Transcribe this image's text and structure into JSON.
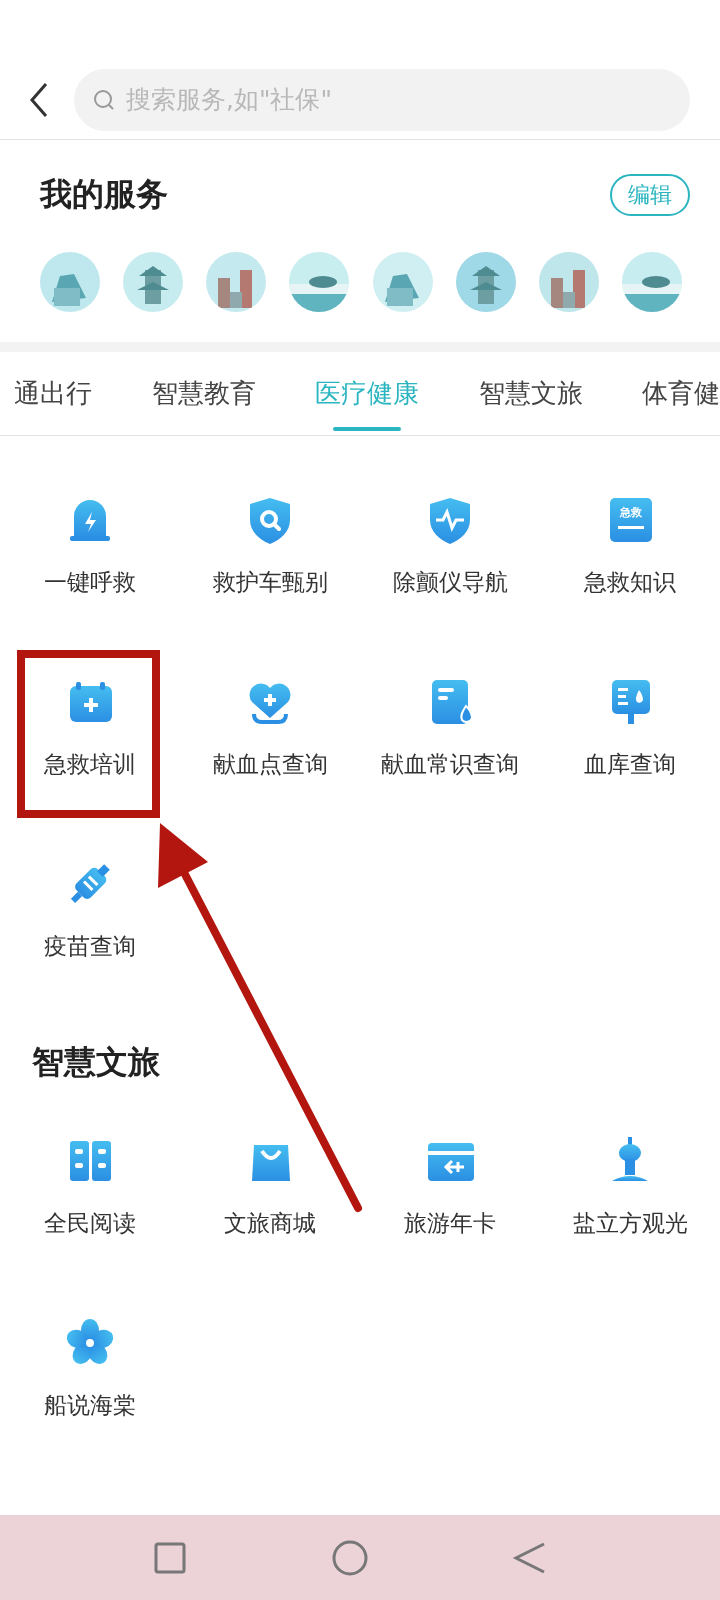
{
  "search": {
    "placeholder": "搜索服务,如\"社保\""
  },
  "my_services": {
    "title": "我的服务",
    "edit_button": "编辑"
  },
  "tabs": [
    {
      "label": "通出行",
      "selected": false
    },
    {
      "label": "智慧教育",
      "selected": false
    },
    {
      "label": "医疗健康",
      "selected": true
    },
    {
      "label": "智慧文旅",
      "selected": false
    },
    {
      "label": "体育健",
      "selected": false
    }
  ],
  "sections": [
    {
      "items": [
        {
          "label": "一键呼救"
        },
        {
          "label": "救护车甄别"
        },
        {
          "label": "除颤仪导航"
        },
        {
          "label": "急救知识",
          "icon_text": "急救"
        },
        {
          "label": "急救培训"
        },
        {
          "label": "献血点查询"
        },
        {
          "label": "献血常识查询"
        },
        {
          "label": "血库查询"
        },
        {
          "label": "疫苗查询"
        }
      ]
    },
    {
      "title": "智慧文旅",
      "items": [
        {
          "label": "全民阅读"
        },
        {
          "label": "文旅商城"
        },
        {
          "label": "旅游年卡"
        },
        {
          "label": "盐立方观光"
        },
        {
          "label": "船说海棠"
        }
      ]
    }
  ],
  "annotation": {
    "kind": "callout"
  }
}
